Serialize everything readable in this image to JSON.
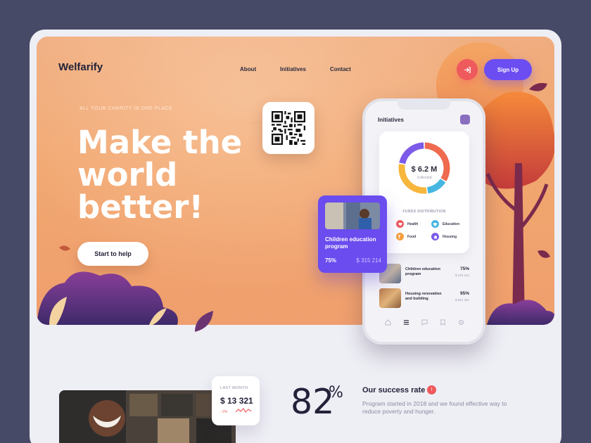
{
  "header": {
    "logo": "Welfarify",
    "nav": [
      "About",
      "Initiatives",
      "Contact"
    ],
    "login_icon": "login-arrow-icon",
    "signup_label": "Sign Up"
  },
  "hero": {
    "tagline": "ALL YOUR CHARITY IN ONE PLACE",
    "headline": "Make the world better!",
    "cta_label": "Start to help"
  },
  "qr": {
    "icon": "qr-code-icon"
  },
  "phone": {
    "title": "Initiatives",
    "donut": {
      "amount": "$ 6.2 M",
      "sublabel": "Collected",
      "segments": [
        {
          "name": "Health",
          "color": "#ef6a4f",
          "value": 0.34
        },
        {
          "name": "Education",
          "color": "#45b6e0",
          "value": 0.14
        },
        {
          "name": "Food",
          "color": "#f7b63c",
          "value": 0.3
        },
        {
          "name": "Housing",
          "color": "#7b5be8",
          "value": 0.22
        }
      ]
    },
    "funds_label": "FUNDS DISTRIBUTION",
    "legend": [
      {
        "label": "Health",
        "color": "#ef5a5d",
        "icon": "heart-icon"
      },
      {
        "label": "Education",
        "color": "#45b6e0",
        "icon": "graduation-cap-icon"
      },
      {
        "label": "Food",
        "color": "#f7a13c",
        "icon": "food-icon"
      },
      {
        "label": "Housing",
        "color": "#7b5be8",
        "icon": "house-icon"
      }
    ],
    "projects": [
      {
        "name": "Children education program",
        "pct": "75%",
        "amount": "$ 315 214"
      },
      {
        "name": "Housing renovation and building",
        "pct": "95%",
        "amount": "$ 621 421"
      }
    ],
    "tabs": [
      "home-icon",
      "list-icon",
      "chat-icon",
      "bookmark-icon",
      "settings-icon"
    ]
  },
  "feature_card": {
    "title": "Children education program",
    "pct": "75%",
    "amount": "$ 315 214"
  },
  "stats": {
    "month_label": "LAST MONTH",
    "month_amount": "$ 13 321",
    "month_trend": "- 2%",
    "big_pct": "82",
    "big_sym": "%",
    "success_title": "Our success rate",
    "success_badge": "!",
    "success_desc": "Program started in 2018 and we found effective way to reduce poverty and hunger."
  },
  "colors": {
    "accent": "#6b4df2",
    "coral": "#ef5a5d",
    "hero_bg": "#f1a66f",
    "page_bg": "#474a66"
  }
}
